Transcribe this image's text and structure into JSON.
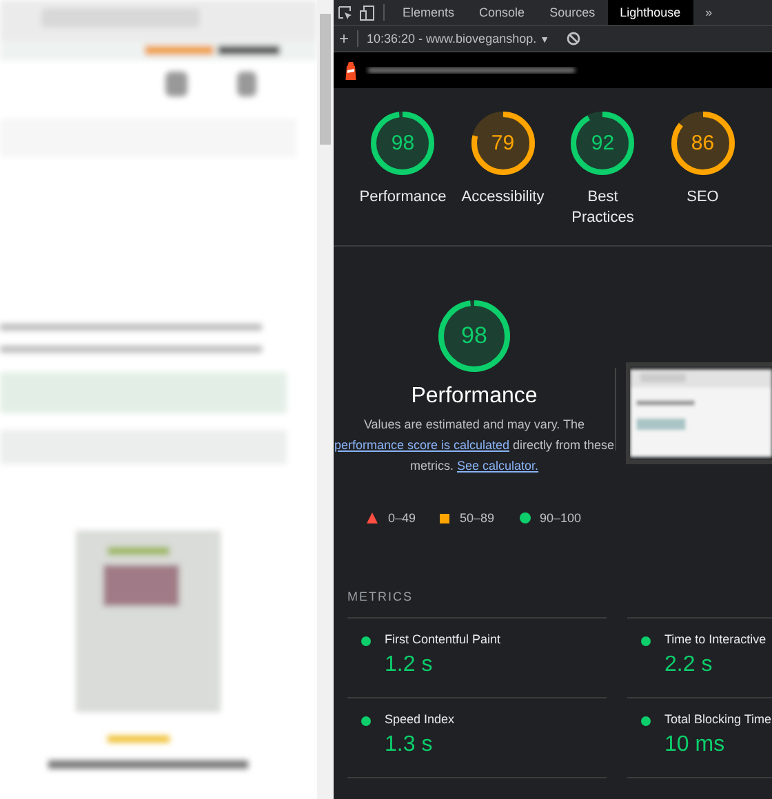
{
  "devtools": {
    "tabs": [
      {
        "label": "Elements",
        "selected": false
      },
      {
        "label": "Console",
        "selected": false
      },
      {
        "label": "Sources",
        "selected": false
      },
      {
        "label": "Lighthouse",
        "selected": true
      }
    ],
    "overflow": "»",
    "toolbar": {
      "add": "+",
      "report": "10:36:20 - www.bioveganshop.",
      "dropdown": "▼"
    }
  },
  "scores": [
    {
      "score": "98",
      "label": "Performance",
      "level": 0.98,
      "color": "#0cce6b"
    },
    {
      "score": "79",
      "label": "Accessibility",
      "level": 0.79,
      "color": "#ffa400"
    },
    {
      "score": "92",
      "label": "Best Practices",
      "level": 0.92,
      "color": "#0cce6b"
    },
    {
      "score": "86",
      "label": "SEO",
      "level": 0.86,
      "color": "#ffa400"
    }
  ],
  "performance": {
    "score": "98",
    "level": 0.98,
    "color": "#0cce6b",
    "title": "Performance",
    "text_before": "Values are estimated and may vary. The ",
    "link": "performance score is calculated",
    "text_middle": " directly from these metrics. ",
    "link2": "See calculator.",
    "legend": [
      {
        "kind": "fail",
        "range": "0–49"
      },
      {
        "kind": "average",
        "range": "50–89"
      },
      {
        "kind": "pass",
        "range": "90–100"
      }
    ]
  },
  "metrics": {
    "heading": "METRICS",
    "items": [
      {
        "label": "First Contentful Paint",
        "value": "1.2 s",
        "color": "#0cce6b"
      },
      {
        "label": "Time to Interactive",
        "value": "2.2 s",
        "color": "#0cce6b"
      },
      {
        "label": "Speed Index",
        "value": "1.3 s",
        "color": "#0cce6b"
      },
      {
        "label": "Total Blocking Time",
        "value": "10 ms",
        "color": "#0cce6b"
      }
    ]
  }
}
